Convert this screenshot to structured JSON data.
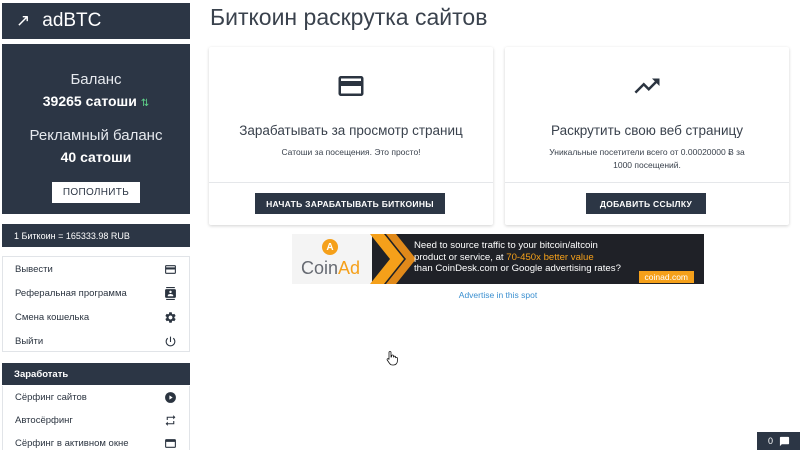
{
  "logo": {
    "name": "adBTC"
  },
  "balance": {
    "label": "Баланс",
    "value": "39265 сатоши",
    "ad_label": "Рекламный баланс",
    "ad_value": "40 сатоши",
    "topup_label": "ПОПОЛНИТЬ"
  },
  "rate": "1 Биткоин = 165333.98 RUB",
  "menu": {
    "items": [
      {
        "label": "Вывести",
        "icon": "credit-card-icon"
      },
      {
        "label": "Реферальная программа",
        "icon": "contacts-icon"
      },
      {
        "label": "Смена кошелька",
        "icon": "gear-icon"
      },
      {
        "label": "Выйти",
        "icon": "power-icon"
      }
    ]
  },
  "earn": {
    "header": "Заработать",
    "items": [
      {
        "label": "Сёрфинг сайтов",
        "icon": "play-circle-icon"
      },
      {
        "label": "Автосёрфинг",
        "icon": "repeat-icon"
      },
      {
        "label": "Сёрфинг в активном окне",
        "icon": "window-icon"
      }
    ]
  },
  "page": {
    "title": "Биткоин раскрутка сайтов"
  },
  "cards": [
    {
      "icon": "credit-card-icon",
      "title": "Зарабатывать за просмотр страниц",
      "desc": "Сатоши за посещения. Это просто!",
      "button": "НАЧАТЬ ЗАРАБАТЫВАТЬ БИТКОИНЫ"
    },
    {
      "icon": "trending-up-icon",
      "title": "Раскрутить свою веб страницу",
      "desc": "Уникальные посетители всего от 0.00020000 Ƀ за 1000 посещений.",
      "button": "ДОБАВИТЬ ССЫЛКУ"
    }
  ],
  "banner": {
    "logo_coin": "Coin",
    "logo_ad": "Ad",
    "coin_letter": "A",
    "line1": "Need to source traffic to your bitcoin/altcoin",
    "line2a": "product or service, at ",
    "line2b": "70-450x better value",
    "line3": "than CoinDesk.com or Google advertising rates?",
    "site": "coinad.com"
  },
  "advertise_link": "Advertise in this spot",
  "counter": {
    "value": "0",
    "icon": "chat-icon"
  },
  "colors": {
    "dark": "#2c3645",
    "accent": "#f5a01a",
    "link": "#3a8fd0",
    "up": "#5fd38a"
  }
}
